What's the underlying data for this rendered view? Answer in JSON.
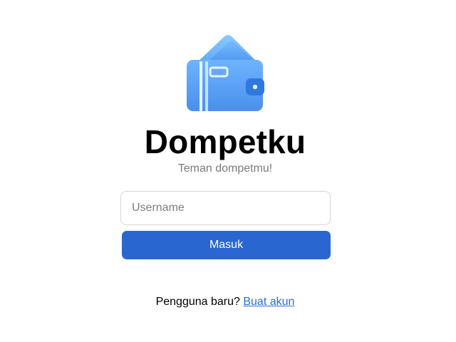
{
  "app": {
    "name": "Dompetku",
    "tagline": "Teman dompetmu!"
  },
  "logo": {
    "icon": "wallet-icon",
    "colors": {
      "card_back": "#7fc0ff",
      "card_front": "#5aa6f7",
      "wallet_body": "#4f97f2",
      "wallet_light": "#6fb3ff",
      "stripe": "#e6f2ff",
      "clasp": "#2f78e0"
    }
  },
  "form": {
    "username_placeholder": "Username",
    "username_value": "",
    "submit_label": "Masuk"
  },
  "signup": {
    "prompt": "Pengguna baru?",
    "link_label": "Buat akun"
  },
  "colors": {
    "primary_button": "#2a66cf",
    "link": "#2a6ed8",
    "subtitle": "#7a7a7a",
    "input_border": "#d6d6d6"
  }
}
